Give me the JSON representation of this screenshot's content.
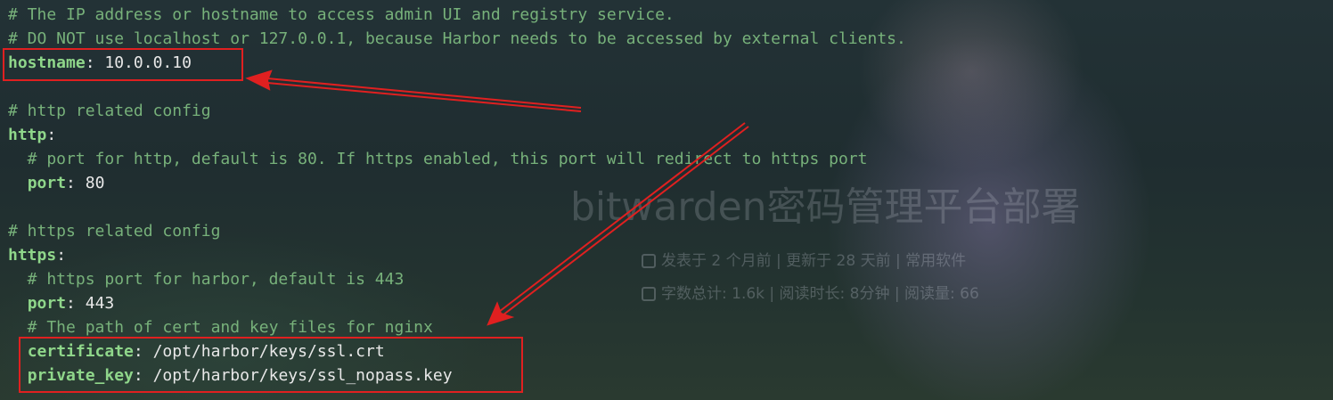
{
  "code_lines": [
    {
      "comment": "# The IP address or hostname to access admin UI and registry service."
    },
    {
      "comment": "# DO NOT use localhost or 127.0.0.1, because Harbor needs to be accessed by external clients."
    },
    {
      "key": "hostname",
      "value": " 10.0.0.10",
      "indent": ""
    },
    {
      "blank": true
    },
    {
      "comment": "# http related config"
    },
    {
      "key": "http",
      "value": "",
      "indent": ""
    },
    {
      "comment": "  # port for http, default is 80. If https enabled, this port will redirect to https port"
    },
    {
      "key": "port",
      "value": " 80",
      "indent": "  "
    },
    {
      "blank": true
    },
    {
      "comment": "# https related config"
    },
    {
      "key": "https",
      "value": "",
      "indent": ""
    },
    {
      "comment": "  # https port for harbor, default is 443"
    },
    {
      "key": "port",
      "value": " 443",
      "indent": "  "
    },
    {
      "comment": "  # The path of cert and key files for nginx"
    },
    {
      "key": "certificate",
      "value": " /opt/harbor/keys/ssl.crt",
      "indent": "  "
    },
    {
      "key": "private_key",
      "value": " /opt/harbor/keys/ssl_nopass.key",
      "indent": "  "
    }
  ],
  "background": {
    "title": "bitwarden密码管理平台部署",
    "meta_line1": "发表于 2 个月前 | 更新于 28 天前 | 常用软件",
    "meta_line2": "字数总计: 1.6k | 阅读时长: 8分钟 | 阅读量: 66"
  },
  "colors": {
    "comment": "#77b17a",
    "key": "#8fd68a",
    "value": "#e8e8e8",
    "annotation": "#e02020"
  }
}
